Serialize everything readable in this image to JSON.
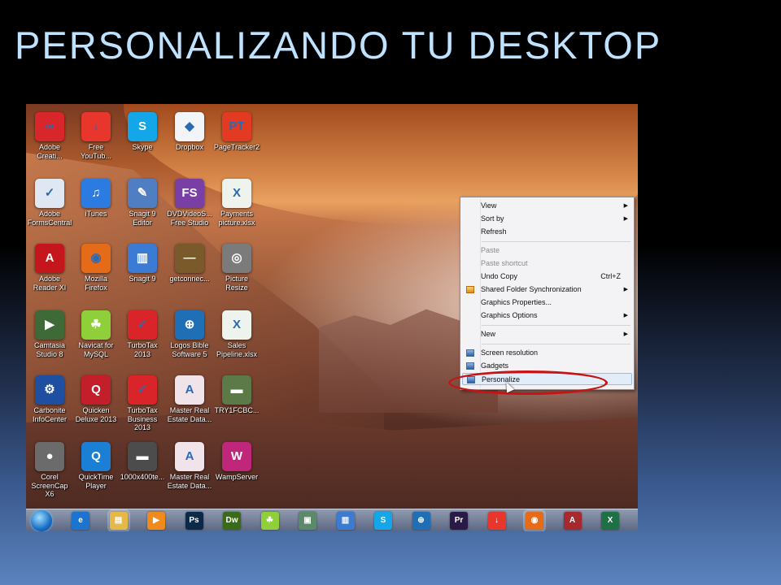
{
  "slide": {
    "title": "PERSONALIZANDO TU DESKTOP"
  },
  "desktop": {
    "icons": [
      {
        "label": "Adobe\nCreati...",
        "icon": "creative-cloud-icon",
        "color": "#d8262a",
        "glyph": "∞"
      },
      {
        "label": "Free\nYouTub...",
        "icon": "download-arrow-icon",
        "color": "#e8362c",
        "glyph": "↓"
      },
      {
        "label": "Skype",
        "icon": "skype-icon",
        "color": "#13a6e9",
        "glyph": "S"
      },
      {
        "label": "Dropbox",
        "icon": "dropbox-icon",
        "color": "#f2f4f7",
        "glyph": "◆"
      },
      {
        "label": "PageTracker2",
        "icon": "pagetracker-icon",
        "color": "#e23b22",
        "glyph": "PT"
      },
      {
        "label": "Adobe\nFormsCentral",
        "icon": "forms-central-icon",
        "color": "#dfe8f2",
        "glyph": "✓"
      },
      {
        "label": "iTunes",
        "icon": "itunes-icon",
        "color": "#2b7be0",
        "glyph": "♫"
      },
      {
        "label": "Snagit 9\nEditor",
        "icon": "snagit-editor-icon",
        "color": "#4f7fc2",
        "glyph": "✎"
      },
      {
        "label": "DVDVideoS...\nFree Studio",
        "icon": "free-studio-icon",
        "color": "#7a3fa5",
        "glyph": "FS"
      },
      {
        "label": "Payments\npicture.xlsx",
        "icon": "excel-file-icon",
        "color": "#eef3ee",
        "glyph": "X"
      },
      {
        "label": "Adobe\nReader XI",
        "icon": "adobe-reader-icon",
        "color": "#c4161c",
        "glyph": "A"
      },
      {
        "label": "Mozilla\nFirefox",
        "icon": "firefox-icon",
        "color": "#e66b18",
        "glyph": "◉"
      },
      {
        "label": "Snagit 9",
        "icon": "snagit-icon",
        "color": "#3b7bd4",
        "glyph": "▥"
      },
      {
        "label": "getconnec...",
        "icon": "shortcut-file-icon",
        "color": "#7a5a2a",
        "glyph": "—"
      },
      {
        "label": "Picture Resize",
        "icon": "picture-resize-icon",
        "color": "#7b7b7b",
        "glyph": "◎"
      },
      {
        "label": "Camtasia\nStudio 8",
        "icon": "camtasia-icon",
        "color": "#3d6a37",
        "glyph": "▶"
      },
      {
        "label": "Navicat for\nMySQL",
        "icon": "navicat-icon",
        "color": "#8fcf3a",
        "glyph": "☘"
      },
      {
        "label": "TurboTax\n2013",
        "icon": "turbotax-icon",
        "color": "#d9242a",
        "glyph": "✓"
      },
      {
        "label": "Logos Bible\nSoftware 5",
        "icon": "logos-bible-icon",
        "color": "#1f6fb7",
        "glyph": "⊕"
      },
      {
        "label": "Sales\nPipeline.xlsx",
        "icon": "excel-file-icon",
        "color": "#eef3ee",
        "glyph": "X"
      },
      {
        "label": "Carbonite\nInfoCenter",
        "icon": "carbonite-icon",
        "color": "#1f4fa0",
        "glyph": "⚙"
      },
      {
        "label": "Quicken\nDeluxe 2013",
        "icon": "quicken-icon",
        "color": "#c31f2a",
        "glyph": "Q"
      },
      {
        "label": "TurboTax\nBusiness 2013",
        "icon": "turbotax-business-icon",
        "color": "#d9242a",
        "glyph": "✓"
      },
      {
        "label": "Master Real\nEstate Data...",
        "icon": "access-file-icon",
        "color": "#f1e3ea",
        "glyph": "A"
      },
      {
        "label": "TRY1FCBC...",
        "icon": "image-file-icon",
        "color": "#5c7a48",
        "glyph": "▬"
      },
      {
        "label": "Corel\nScreenCap X6",
        "icon": "corel-screencap-icon",
        "color": "#6b6b6b",
        "glyph": "●"
      },
      {
        "label": "QuickTime\nPlayer",
        "icon": "quicktime-icon",
        "color": "#1c7fd6",
        "glyph": "Q"
      },
      {
        "label": "1000x400te...",
        "icon": "image-file-icon",
        "color": "#4c4c4c",
        "glyph": "▬"
      },
      {
        "label": "Master Real\nEstate Data...",
        "icon": "access-file-icon",
        "color": "#f1e3ea",
        "glyph": "A"
      },
      {
        "label": "WampServer",
        "icon": "wampserver-icon",
        "color": "#c0267a",
        "glyph": "W"
      }
    ]
  },
  "context_menu": {
    "items": [
      {
        "label": "View",
        "submenu": true
      },
      {
        "label": "Sort by",
        "submenu": true
      },
      {
        "label": "Refresh"
      },
      {
        "separator": true
      },
      {
        "label": "Paste",
        "disabled": true
      },
      {
        "label": "Paste shortcut",
        "disabled": true
      },
      {
        "label": "Undo Copy",
        "shortcut": "Ctrl+Z"
      },
      {
        "label": "Shared Folder Synchronization",
        "submenu": true,
        "icon": "shared-folder-sync-icon"
      },
      {
        "label": "Graphics Properties..."
      },
      {
        "label": "Graphics Options",
        "submenu": true
      },
      {
        "separator": true
      },
      {
        "label": "New",
        "submenu": true
      },
      {
        "separator": true
      },
      {
        "label": "Screen resolution",
        "icon": "screen-resolution-icon"
      },
      {
        "label": "Gadgets",
        "icon": "gadgets-icon"
      },
      {
        "label": "Personalize",
        "icon": "personalize-icon",
        "highlighted": true
      }
    ]
  },
  "taskbar": {
    "items": [
      {
        "name": "internet-explorer-icon",
        "color": "#1b75d0",
        "glyph": "e"
      },
      {
        "name": "file-explorer-icon",
        "color": "#e4b94a",
        "glyph": "▤",
        "pinned": true
      },
      {
        "name": "media-player-icon",
        "color": "#f08a1c",
        "glyph": "▶"
      },
      {
        "name": "photoshop-icon",
        "color": "#0b2a4a",
        "glyph": "Ps"
      },
      {
        "name": "dreamweaver-icon",
        "color": "#3a6b1a",
        "glyph": "Dw"
      },
      {
        "name": "navicat-icon",
        "color": "#8fcf3a",
        "glyph": "☘"
      },
      {
        "name": "screen-capture-icon",
        "color": "#5a8a6a",
        "glyph": "▣"
      },
      {
        "name": "snagit-icon",
        "color": "#3b7bd4",
        "glyph": "▥"
      },
      {
        "name": "skype-icon",
        "color": "#13a6e9",
        "glyph": "S"
      },
      {
        "name": "logos-bible-icon",
        "color": "#1f6fb7",
        "glyph": "⊕"
      },
      {
        "name": "premiere-icon",
        "color": "#2a1a48",
        "glyph": "Pr"
      },
      {
        "name": "download-arrow-icon",
        "color": "#e8362c",
        "glyph": "↓"
      },
      {
        "name": "firefox-icon",
        "color": "#e66b18",
        "glyph": "◉",
        "pinned": true
      },
      {
        "name": "access-icon",
        "color": "#a5292f",
        "glyph": "A"
      },
      {
        "name": "excel-icon",
        "color": "#1e7145",
        "glyph": "X"
      }
    ]
  }
}
